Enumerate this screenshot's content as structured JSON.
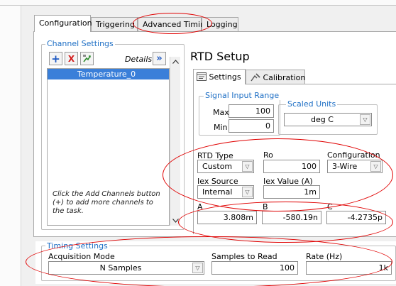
{
  "tabs": [
    "Configuration",
    "Triggering",
    "Advanced Timing",
    "Logging"
  ],
  "channel_settings": {
    "legend": "Channel Settings",
    "details_label": "Details",
    "details_glyph": "»",
    "add_glyph": "+",
    "remove_glyph": "X",
    "channels": [
      "Temperature_0"
    ],
    "hint": "Click the Add Channels button (+) to add more channels to the task."
  },
  "rtd": {
    "title": "RTD Setup",
    "subtabs": [
      "Settings",
      "Calibration"
    ],
    "signal_input_range": {
      "legend": "Signal Input Range",
      "max_label": "Max",
      "max_value": "100",
      "min_label": "Min",
      "min_value": "0"
    },
    "scaled_units": {
      "legend": "Scaled Units",
      "value": "deg C"
    },
    "rtd_type": {
      "label": "RTD Type",
      "value": "Custom"
    },
    "ro": {
      "label": "Ro",
      "value": "100"
    },
    "configuration": {
      "label": "Configuration",
      "value": "3-Wire"
    },
    "iex_source": {
      "label": "Iex Source",
      "value": "Internal"
    },
    "iex_value": {
      "label": "Iex Value (A)",
      "value": "1m"
    },
    "a": {
      "label": "A",
      "value": "3.808m"
    },
    "b": {
      "label": "B",
      "value": "-580.19n"
    },
    "c": {
      "label": "C",
      "value": "-4.2735p"
    }
  },
  "timing": {
    "legend": "Timing Settings",
    "acquisition_mode_label": "Acquisition Mode",
    "acquisition_mode_value": "N Samples",
    "samples_label": "Samples to Read",
    "samples_value": "100",
    "rate_label": "Rate (Hz)",
    "rate_value": "1k"
  },
  "colors": {
    "selection": "#3a7fd9",
    "group_legend": "#1e6fc5",
    "annotation": "#e00000"
  }
}
